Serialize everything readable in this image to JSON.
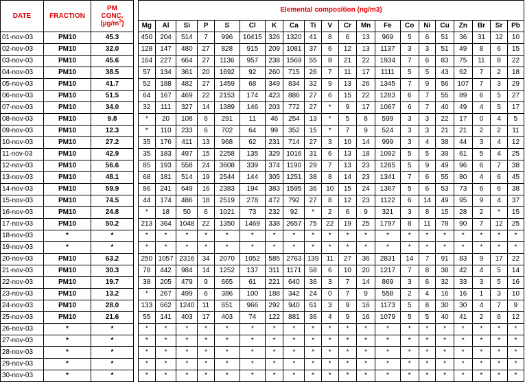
{
  "headers": {
    "date": "DATE",
    "fraction": "FRACTION",
    "pm_conc_line1": "PM",
    "pm_conc_line2": "CONC.",
    "pm_conc_unit_pre": "(µg/m",
    "pm_conc_unit_sup": "3",
    "pm_conc_unit_post": ")",
    "elemental_title": "Elemental composition (ng/m3)"
  },
  "elements": [
    "Mg",
    "Al",
    "Si",
    "P",
    "S",
    "Cl",
    "K",
    "Ca",
    "Ti",
    "V",
    "Cr",
    "Mn",
    "Fe",
    "Co",
    "Ni",
    "Cu",
    "Zn",
    "Br",
    "Sr",
    "Pb"
  ],
  "rows": [
    {
      "date": "01-nov-03",
      "fraction": "PM10",
      "conc": "45.3",
      "values": [
        "450",
        "204",
        "514",
        "7",
        "996",
        "10415",
        "326",
        "1320",
        "41",
        "8",
        "6",
        "13",
        "969",
        "5",
        "6",
        "51",
        "36",
        "31",
        "12",
        "10"
      ]
    },
    {
      "date": "02-nov-03",
      "fraction": "PM10",
      "conc": "32.0",
      "values": [
        "128",
        "147",
        "480",
        "27",
        "828",
        "915",
        "209",
        "1081",
        "37",
        "6",
        "12",
        "13",
        "1137",
        "3",
        "3",
        "51",
        "49",
        "8",
        "6",
        "15"
      ]
    },
    {
      "date": "03-nov-03",
      "fraction": "PM10",
      "conc": "45.6",
      "values": [
        "164",
        "227",
        "664",
        "27",
        "1136",
        "957",
        "238",
        "1569",
        "55",
        "8",
        "21",
        "22",
        "1934",
        "7",
        "6",
        "83",
        "75",
        "11",
        "8",
        "22"
      ]
    },
    {
      "date": "04-nov-03",
      "fraction": "PM10",
      "conc": "38.5",
      "values": [
        "57",
        "134",
        "361",
        "20",
        "1692",
        "92",
        "260",
        "715",
        "26",
        "7",
        "11",
        "17",
        "1111",
        "5",
        "5",
        "43",
        "62",
        "7",
        "2",
        "18"
      ]
    },
    {
      "date": "05-nov-03",
      "fraction": "PM10",
      "conc": "41.7",
      "values": [
        "52",
        "188",
        "482",
        "27",
        "1459",
        "68",
        "349",
        "834",
        "32",
        "9",
        "13",
        "26",
        "1345",
        "7",
        "9",
        "56",
        "107",
        "7",
        "3",
        "29"
      ]
    },
    {
      "date": "06-nov-03",
      "fraction": "PM10",
      "conc": "51.5",
      "values": [
        "64",
        "167",
        "469",
        "22",
        "2153",
        "174",
        "423",
        "886",
        "27",
        "6",
        "15",
        "22",
        "1283",
        "6",
        "7",
        "55",
        "89",
        "6",
        "5",
        "27"
      ]
    },
    {
      "date": "07-nov-03",
      "fraction": "PM10",
      "conc": "34.0",
      "values": [
        "32",
        "111",
        "327",
        "14",
        "1389",
        "146",
        "203",
        "772",
        "27",
        "*",
        "9",
        "17",
        "1067",
        "6",
        "7",
        "40",
        "49",
        "4",
        "5",
        "17"
      ]
    },
    {
      "date": "08-nov-03",
      "fraction": "PM10",
      "conc": "9.8",
      "values": [
        "*",
        "20",
        "108",
        "6",
        "291",
        "11",
        "46",
        "254",
        "13",
        "*",
        "5",
        "8",
        "599",
        "3",
        "3",
        "22",
        "17",
        "0",
        "4",
        "5"
      ]
    },
    {
      "date": "09-nov-03",
      "fraction": "PM10",
      "conc": "12.3",
      "values": [
        "*",
        "110",
        "233",
        "6",
        "702",
        "64",
        "99",
        "352",
        "15",
        "*",
        "7",
        "9",
        "524",
        "3",
        "3",
        "21",
        "21",
        "2",
        "2",
        "11"
      ]
    },
    {
      "date": "10-nov-03",
      "fraction": "PM10",
      "conc": "27.2",
      "values": [
        "35",
        "176",
        "411",
        "13",
        "968",
        "62",
        "231",
        "714",
        "27",
        "3",
        "10",
        "14",
        "999",
        "3",
        "4",
        "38",
        "44",
        "3",
        "4",
        "12"
      ]
    },
    {
      "date": "11-nov-03",
      "fraction": "PM10",
      "conc": "42.9",
      "values": [
        "35",
        "183",
        "497",
        "15",
        "2258",
        "135",
        "329",
        "1016",
        "31",
        "6",
        "13",
        "18",
        "1092",
        "5",
        "5",
        "39",
        "61",
        "5",
        "4",
        "25"
      ]
    },
    {
      "date": "12-nov-03",
      "fraction": "PM10",
      "conc": "56.6",
      "values": [
        "85",
        "193",
        "558",
        "24",
        "3608",
        "339",
        "374",
        "1190",
        "29",
        "7",
        "13",
        "23",
        "1285",
        "5",
        "9",
        "49",
        "96",
        "6",
        "7",
        "38"
      ]
    },
    {
      "date": "13-nov-03",
      "fraction": "PM10",
      "conc": "48.1",
      "values": [
        "68",
        "181",
        "514",
        "19",
        "2544",
        "144",
        "305",
        "1251",
        "38",
        "8",
        "14",
        "23",
        "1341",
        "7",
        "6",
        "55",
        "80",
        "4",
        "6",
        "45"
      ]
    },
    {
      "date": "14-nov-03",
      "fraction": "PM10",
      "conc": "59.9",
      "values": [
        "86",
        "241",
        "649",
        "16",
        "2383",
        "194",
        "383",
        "1595",
        "36",
        "10",
        "15",
        "24",
        "1367",
        "5",
        "6",
        "53",
        "73",
        "6",
        "6",
        "38"
      ]
    },
    {
      "date": "15-nov-03",
      "fraction": "PM10",
      "conc": "74.5",
      "values": [
        "44",
        "174",
        "486",
        "18",
        "2519",
        "278",
        "472",
        "792",
        "27",
        "8",
        "12",
        "23",
        "1122",
        "6",
        "14",
        "49",
        "95",
        "9",
        "4",
        "37"
      ]
    },
    {
      "date": "16-nov-03",
      "fraction": "PM10",
      "conc": "24.8",
      "values": [
        "*",
        "18",
        "50",
        "6",
        "1021",
        "73",
        "232",
        "92",
        "*",
        "2",
        "6",
        "9",
        "321",
        "3",
        "8",
        "15",
        "28",
        "2",
        "*",
        "15"
      ]
    },
    {
      "date": "17-nov-03",
      "fraction": "PM10",
      "conc": "50.2",
      "values": [
        "213",
        "364",
        "1048",
        "22",
        "1350",
        "1469",
        "338",
        "2657",
        "75",
        "22",
        "19",
        "25",
        "1797",
        "8",
        "11",
        "78",
        "90",
        "7",
        "12",
        "25"
      ]
    },
    {
      "date": "18-nov-03",
      "fraction": "*",
      "conc": "*",
      "values": [
        "*",
        "*",
        "*",
        "*",
        "*",
        "*",
        "*",
        "*",
        "*",
        "*",
        "*",
        "*",
        "*",
        "*",
        "*",
        "*",
        "*",
        "*",
        "*",
        "*"
      ]
    },
    {
      "date": "19-nov-03",
      "fraction": "*",
      "conc": "*",
      "values": [
        "*",
        "*",
        "*",
        "*",
        "*",
        "*",
        "*",
        "*",
        "*",
        "*",
        "*",
        "*",
        "*",
        "*",
        "*",
        "*",
        "*",
        "*",
        "*",
        "*"
      ]
    },
    {
      "date": "20-nov-03",
      "fraction": "PM10",
      "conc": "63.2",
      "values": [
        "250",
        "1057",
        "2316",
        "34",
        "2070",
        "1052",
        "585",
        "2763",
        "139",
        "11",
        "27",
        "36",
        "2831",
        "14",
        "7",
        "91",
        "83",
        "9",
        "17",
        "22"
      ]
    },
    {
      "date": "21-nov-03",
      "fraction": "PM10",
      "conc": "30.3",
      "values": [
        "78",
        "442",
        "984",
        "14",
        "1252",
        "137",
        "311",
        "1171",
        "58",
        "6",
        "10",
        "20",
        "1217",
        "7",
        "8",
        "38",
        "42",
        "4",
        "5",
        "14"
      ]
    },
    {
      "date": "22-nov-03",
      "fraction": "PM10",
      "conc": "19.7",
      "values": [
        "38",
        "205",
        "479",
        "9",
        "665",
        "61",
        "221",
        "640",
        "36",
        "3",
        "7",
        "14",
        "869",
        "3",
        "6",
        "32",
        "33",
        "3",
        "5",
        "16"
      ]
    },
    {
      "date": "23-nov-03",
      "fraction": "PM10",
      "conc": "13.2",
      "values": [
        "*",
        "267",
        "499",
        "6",
        "386",
        "100",
        "188",
        "342",
        "24",
        "0",
        "7",
        "9",
        "558",
        "2",
        "4",
        "16",
        "16",
        "1",
        "3",
        "10"
      ]
    },
    {
      "date": "24-nov-03",
      "fraction": "PM10",
      "conc": "28.0",
      "values": [
        "133",
        "662",
        "1240",
        "11",
        "651",
        "966",
        "292",
        "940",
        "61",
        "3",
        "9",
        "16",
        "1173",
        "5",
        "8",
        "30",
        "30",
        "4",
        "7",
        "9"
      ]
    },
    {
      "date": "25-nov-03",
      "fraction": "PM10",
      "conc": "21.6",
      "values": [
        "55",
        "141",
        "403",
        "17",
        "403",
        "74",
        "122",
        "881",
        "36",
        "4",
        "9",
        "16",
        "1079",
        "5",
        "5",
        "40",
        "41",
        "2",
        "6",
        "12"
      ]
    },
    {
      "date": "26-nov-03",
      "fraction": "*",
      "conc": "*",
      "values": [
        "*",
        "*",
        "*",
        "*",
        "*",
        "*",
        "*",
        "*",
        "*",
        "*",
        "*",
        "*",
        "*",
        "*",
        "*",
        "*",
        "*",
        "*",
        "*",
        "*"
      ]
    },
    {
      "date": "27-nov-03",
      "fraction": "*",
      "conc": "*",
      "values": [
        "*",
        "*",
        "*",
        "*",
        "*",
        "*",
        "*",
        "*",
        "*",
        "*",
        "*",
        "*",
        "*",
        "*",
        "*",
        "*",
        "*",
        "*",
        "*",
        "*"
      ]
    },
    {
      "date": "28-nov-03",
      "fraction": "*",
      "conc": "*",
      "values": [
        "*",
        "*",
        "*",
        "*",
        "*",
        "*",
        "*",
        "*",
        "*",
        "*",
        "*",
        "*",
        "*",
        "*",
        "*",
        "*",
        "*",
        "*",
        "*",
        "*"
      ]
    },
    {
      "date": "29-nov-03",
      "fraction": "*",
      "conc": "*",
      "values": [
        "*",
        "*",
        "*",
        "*",
        "*",
        "*",
        "*",
        "*",
        "*",
        "*",
        "*",
        "*",
        "*",
        "*",
        "*",
        "*",
        "*",
        "*",
        "*",
        "*"
      ]
    },
    {
      "date": "30-nov-03",
      "fraction": "*",
      "conc": "*",
      "values": [
        "*",
        "*",
        "*",
        "*",
        "*",
        "*",
        "*",
        "*",
        "*",
        "*",
        "*",
        "*",
        "*",
        "*",
        "*",
        "*",
        "*",
        "*",
        "*",
        "*"
      ]
    }
  ],
  "colors": {
    "header_text": "#e00000",
    "grid": "#000000",
    "background": "#ffffff"
  }
}
